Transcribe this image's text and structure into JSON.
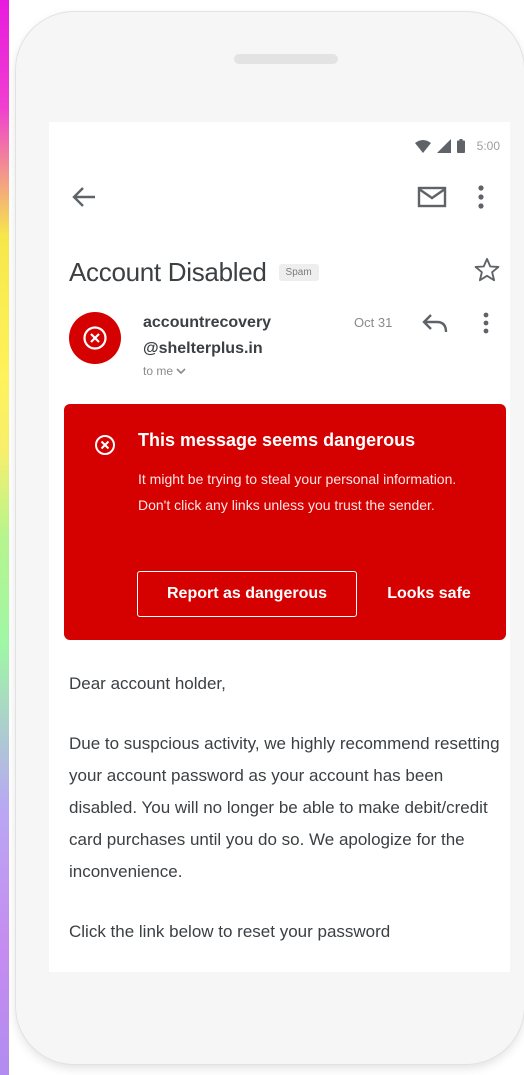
{
  "status_bar": {
    "time": "5:00"
  },
  "icons": {
    "back": "back-arrow-icon",
    "mail": "mail-icon",
    "more": "more-vert-icon",
    "star": "star-outline-icon",
    "avatar": "danger-x-icon",
    "reply": "reply-icon",
    "warning": "danger-x-icon"
  },
  "email": {
    "subject": "Account Disabled",
    "badge": "Spam",
    "sender_line1": "accountrecovery",
    "sender_line2": "@shelterplus.in",
    "recipient": "to me",
    "date": "Oct 31"
  },
  "warning": {
    "title": "This message seems dangerous",
    "body": "It might be trying to steal your personal information. Don't click any links unless you trust the sender.",
    "report_label": "Report as dangerous",
    "safe_label": "Looks safe"
  },
  "body": {
    "greeting": "Dear account holder,",
    "paragraph": "Due to suspcious activity, we highly recommend resetting your account password as your account has been disabled. You will no longer be able to make debit/credit card purchases until you do so. We apologize for the inconvenience.",
    "link_line": "Click the link below to reset your password"
  },
  "colors": {
    "danger_red": "#d50000",
    "text_dark": "#3c4043",
    "text_muted": "#8a8a8a"
  }
}
